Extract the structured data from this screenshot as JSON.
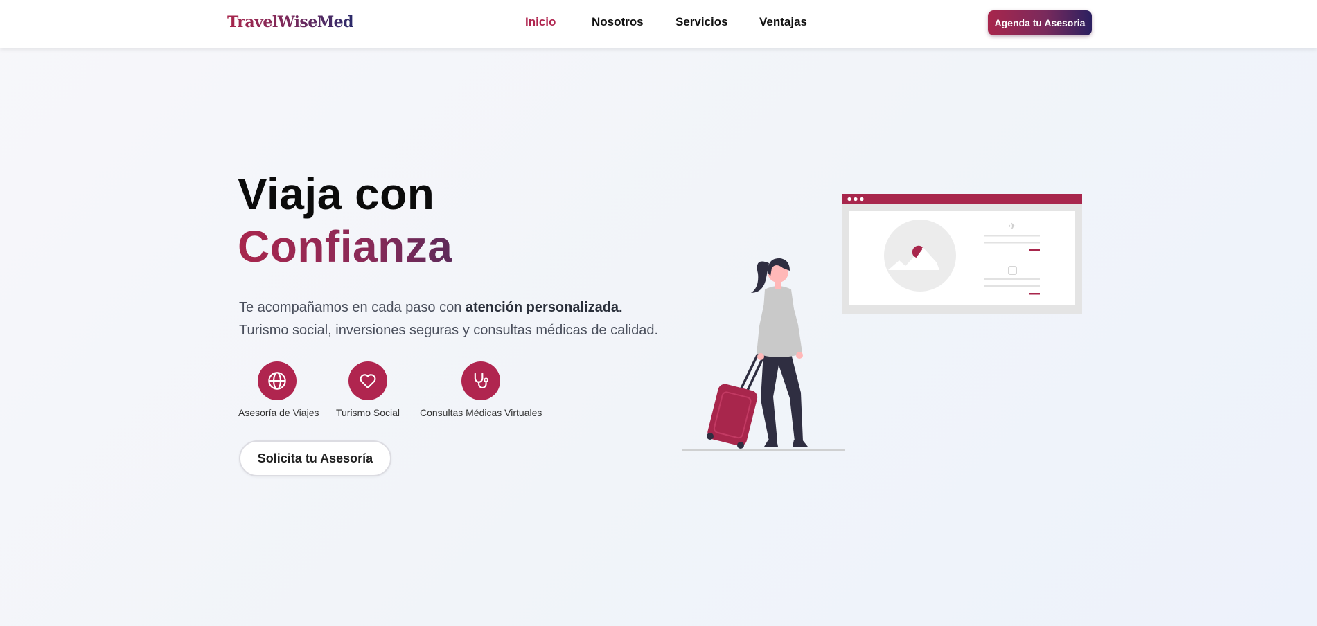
{
  "nav": {
    "logo": "TravelWiseMed",
    "links": [
      {
        "label": "Inicio",
        "active": true
      },
      {
        "label": "Nosotros",
        "active": false
      },
      {
        "label": "Servicios",
        "active": false
      },
      {
        "label": "Ventajas",
        "active": false
      }
    ],
    "cta_label": "Agenda tu Asesoria"
  },
  "hero": {
    "title_line1": "Viaja con",
    "title_line2": "Confianza",
    "subtitle_prefix": "Te acompañamos en cada paso con ",
    "subtitle_bold": "atención personalizada.",
    "subtitle_line2": "Turismo social, inversiones seguras y consultas médicas de calidad.",
    "features": [
      {
        "icon": "globe-icon",
        "label": "Asesoría de Viajes"
      },
      {
        "icon": "heart-icon",
        "label": "Turismo Social"
      },
      {
        "icon": "stethoscope-icon",
        "label": "Consultas Médicas Virtuales"
      }
    ],
    "cta_label": "Solicita tu Asesoría"
  },
  "colors": {
    "brand": "#b0254f",
    "brand_dark": "#2b2060",
    "text": "#0b0b0b",
    "muted": "#4a4f5c"
  }
}
